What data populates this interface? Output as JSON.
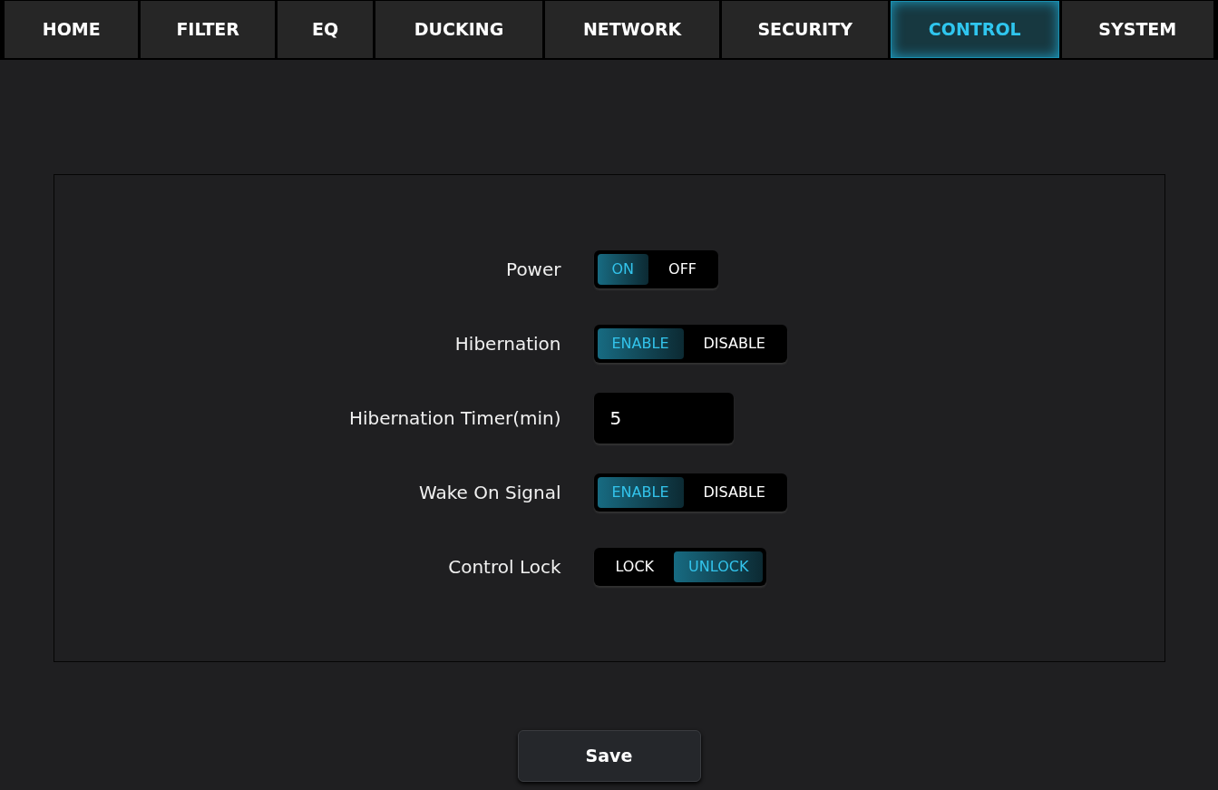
{
  "tabs": [
    {
      "label": "HOME",
      "selected": false
    },
    {
      "label": "FILTER",
      "selected": false
    },
    {
      "label": "EQ",
      "selected": false
    },
    {
      "label": "DUCKING",
      "selected": false
    },
    {
      "label": "NETWORK",
      "selected": false
    },
    {
      "label": "SECURITY",
      "selected": false
    },
    {
      "label": "CONTROL",
      "selected": true
    },
    {
      "label": "SYSTEM",
      "selected": false
    }
  ],
  "settings": [
    {
      "kind": "toggle",
      "label": "Power",
      "options": [
        {
          "label": "ON",
          "selected": true
        },
        {
          "label": "OFF",
          "selected": false
        }
      ]
    },
    {
      "kind": "toggle",
      "label": "Hibernation",
      "options": [
        {
          "label": "ENABLE",
          "selected": true
        },
        {
          "label": "DISABLE",
          "selected": false
        }
      ]
    },
    {
      "kind": "input",
      "label": "Hibernation Timer(min)",
      "value": "5"
    },
    {
      "kind": "toggle",
      "label": "Wake On Signal",
      "options": [
        {
          "label": "ENABLE",
          "selected": true
        },
        {
          "label": "DISABLE",
          "selected": false
        }
      ]
    },
    {
      "kind": "toggle",
      "label": "Control Lock",
      "options": [
        {
          "label": "LOCK",
          "selected": false
        },
        {
          "label": "UNLOCK",
          "selected": true
        }
      ]
    }
  ],
  "save_button": "Save"
}
